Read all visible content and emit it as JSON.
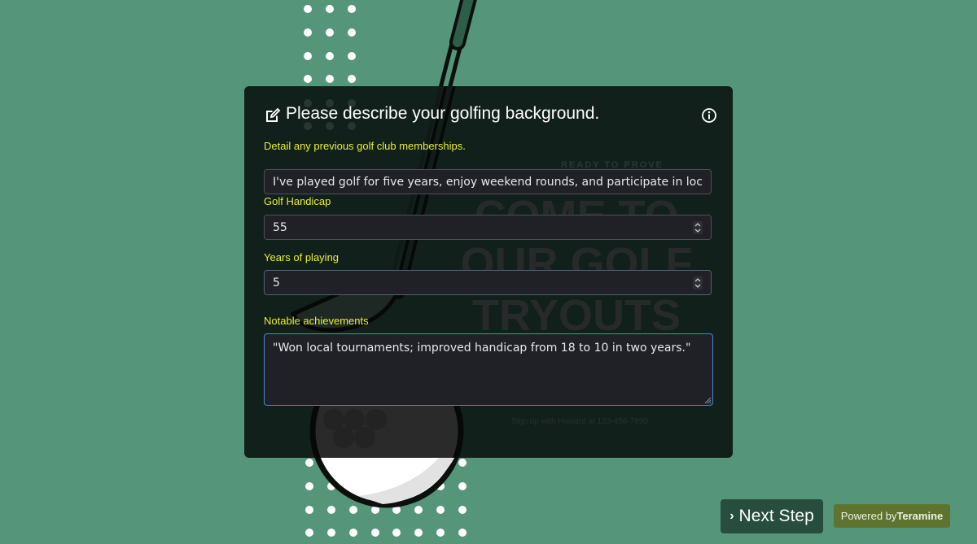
{
  "background": {
    "color": "#55957a",
    "poster": {
      "tagline": "READY TO PROVE",
      "headline_lines": [
        "COME TO",
        "OUR GOLF",
        "TRYOUTS"
      ],
      "footer": "Sign up with Howard at 123-456-7890"
    }
  },
  "form": {
    "title": "Please describe your golfing background.",
    "title_icon": "edit-icon",
    "info_icon": "info-icon",
    "fields": [
      {
        "label": "Detail any previous golf club memberships.",
        "type": "text",
        "value": "I've played golf for five years, enjoy weekend rounds, and participate in local tournaments."
      },
      {
        "label": "Golf Handicap",
        "type": "number",
        "value": "55"
      },
      {
        "label": "Years of playing",
        "type": "number",
        "value": "5"
      },
      {
        "label": "Notable achievements",
        "type": "textarea",
        "value": "\"Won local tournaments; improved handicap from 18 to 10 in two years.\""
      }
    ]
  },
  "footer": {
    "next_button": {
      "label": "Next Step",
      "icon": "chevron-right-icon"
    },
    "powered_by": {
      "prefix": "Powered by",
      "brand": "Teramine"
    }
  },
  "colors": {
    "label": "#e8ed37",
    "next_button": "#264d3d",
    "powered_badge": "#5e742e",
    "focus_border": "#4a87c4"
  }
}
